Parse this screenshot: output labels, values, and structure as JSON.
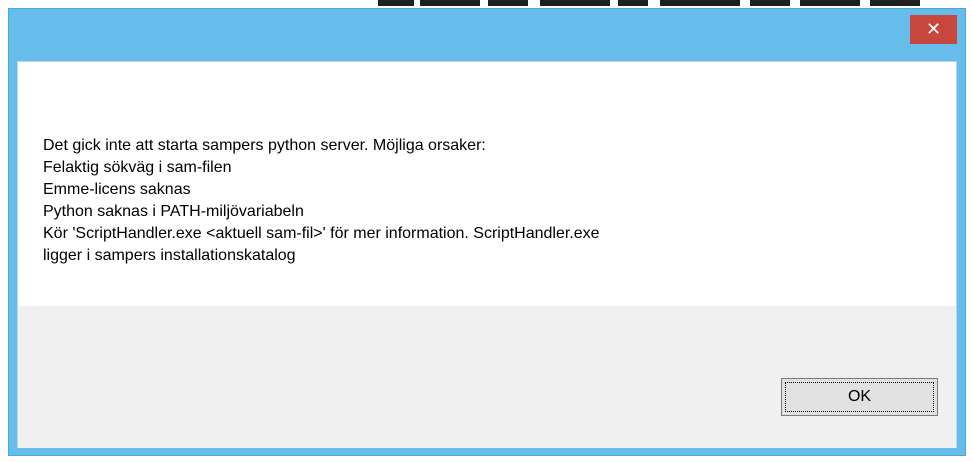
{
  "dialog": {
    "close_glyph": "✕",
    "message_lines": [
      "Det gick inte att starta sampers python server. Möjliga orsaker:",
      "Felaktig sökväg i sam-filen",
      "Emme-licens saknas",
      "Python saknas i PATH-miljövariabeln",
      "Kör 'ScriptHandler.exe <aktuell sam-fil>' för mer information. ScriptHandler.exe",
      "ligger i sampers installationskatalog"
    ],
    "ok_label": "OK"
  },
  "colors": {
    "titlebar": "#66bdeb",
    "close_button": "#c7463d",
    "footer": "#f0f0f0"
  }
}
